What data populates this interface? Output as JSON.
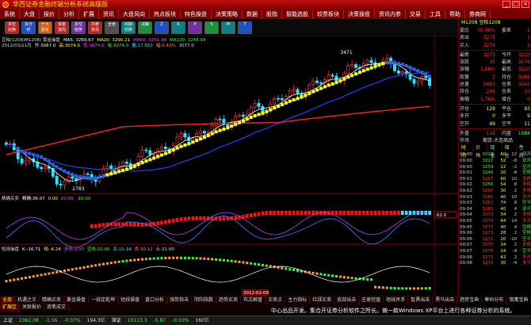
{
  "window": {
    "title": "华西证券金融终端分析系统高级版",
    "buttons": [
      "_",
      "□",
      "×"
    ]
  },
  "menu": [
    "系统",
    "大盘",
    "报价",
    "分析",
    "扩展",
    "资讯",
    "大盘风向",
    "热点板块",
    "特色操盘",
    "决策策略",
    "数据",
    "股指",
    "智能选股",
    "较票板块",
    "决策操盘",
    "资讯内参",
    "交易",
    "工具",
    "帮助",
    "券商网"
  ],
  "toolbar": [
    {
      "label": "多空 切换",
      "color": "red"
    },
    {
      "label": "多分 时",
      "color": "blue"
    },
    {
      "label": "十大 股东",
      "color": "orange"
    },
    {
      "label": "资金 流向",
      "color": "red"
    },
    {
      "label": "多空 趋势",
      "color": "purple"
    },
    {
      "label": "内参 资讯",
      "color": "red"
    },
    {
      "label": "全景",
      "color": "gray"
    },
    {
      "label": "周期 切换",
      "color": "teal"
    },
    {
      "label": "决策",
      "color": "green"
    },
    {
      "label": "Z",
      "color": "blue"
    },
    {
      "label": "K",
      "color": "teal"
    },
    {
      "label": "P",
      "color": "purple"
    },
    {
      "label": "S",
      "color": "green"
    },
    {
      "label": "M",
      "color": "teal"
    },
    {
      "label": "T",
      "color": "blue"
    }
  ],
  "legend1": [
    "豆粕(1208)M1208) 黄金操盘",
    "MA5: 3269.67",
    "MA20: 3290.21",
    "MA60: 3251.48",
    "MA120: 3248.93"
  ],
  "legend2": [
    "2012(03)11月",
    "开:3067.0",
    "高:3074.0",
    "低:3074.0",
    "收:3074.0",
    "量:17.653",
    "幅:0.43%",
    "3077.0"
  ],
  "legend3": [
    "精确买卖",
    "精确:36.07",
    "0.00",
    "20.00",
    "-10.00"
  ],
  "legend4": [
    "短线操盘",
    "K:-16.71",
    "线:-4.24",
    "多线:0.00",
    "空线:20.00",
    "买:10.14",
    "卖:30.12",
    "止:21.00"
  ],
  "annot": {
    "peak": "3471",
    "low": "2783",
    "date": "2012-02-09",
    "right_label": "62.0"
  },
  "chart_data": {
    "type": "candlestick",
    "y_range": [
      2750,
      3500
    ],
    "peak_label": 3471,
    "low_label": 2783
  },
  "right": {
    "header": "M1208 豆粕1208",
    "book": [
      [
        "委比",
        "50.00%",
        "委差",
        "2"
      ],
      [
        "卖出",
        "3275",
        "",
        "1"
      ],
      [
        "买入",
        "3274",
        "",
        "3"
      ]
    ],
    "quote": [
      [
        "最新",
        "3273",
        "今开",
        "3220"
      ],
      [
        "涨跌",
        "35",
        "最高",
        "3276"
      ],
      [
        "涨幅",
        "1.08%",
        "最低",
        "3220"
      ],
      [
        "现量",
        "2",
        "持仓",
        "3386"
      ],
      [
        "总量",
        "2403",
        "仓差",
        "3245"
      ],
      [
        "持仓",
        "206",
        "仓差",
        "10"
      ],
      [
        "振幅",
        "1.76%",
        "增仓",
        "0"
      ]
    ],
    "flow": [
      [
        "开仓",
        "129",
        "平仓",
        "93"
      ],
      [
        "多开",
        "0",
        "多平",
        "9"
      ],
      [
        "空开",
        "49",
        "空平",
        "11"
      ]
    ],
    "outer": [
      "外盘",
      "116",
      "内盘",
      "1084"
    ],
    "market": [
      "市场",
      "期货-大连商品"
    ],
    "tabs": [
      "时间",
      "价格",
      "现量",
      "增仓",
      "性质"
    ],
    "ticks": [
      [
        "09:00",
        "3222",
        "60",
        "12",
        "双开"
      ],
      [
        "09:00",
        "3222",
        "52",
        "-8",
        "双开"
      ],
      [
        "09:00",
        "3254",
        "22",
        "-2",
        "空开"
      ],
      [
        "09:01",
        "3246",
        "20",
        "-8",
        "空换"
      ],
      [
        "09:01",
        "3257",
        "60",
        "10",
        "多换"
      ],
      [
        "09:02",
        "3256",
        "54",
        "8",
        "多换"
      ],
      [
        "09:02",
        "3267",
        "30",
        "2",
        "多换"
      ],
      [
        "09:03",
        "3265",
        "40",
        "10",
        "多开"
      ],
      [
        "09:03",
        "3257",
        "74",
        "8",
        "空平"
      ],
      [
        "09:04",
        "3265",
        "40",
        "4",
        "双平"
      ],
      [
        "09:04",
        "3273",
        "34",
        "2",
        "多换"
      ],
      [
        "09:05",
        "3274",
        "44",
        "14",
        "多开"
      ],
      [
        "09:05",
        "3277",
        "40",
        "4",
        "空换"
      ],
      [
        "09:06",
        "3273",
        "28",
        "2",
        "空换"
      ],
      [
        "09:06",
        "3271",
        "20",
        "-10",
        "空平"
      ],
      [
        "09:07",
        "3270",
        "34",
        "2",
        "多换"
      ],
      [
        "09:07",
        "3275",
        "24",
        "-4",
        "空平"
      ],
      [
        "09:08",
        "3273",
        "42",
        "2",
        "多开"
      ],
      [
        "09:08",
        "3275",
        "30",
        "-4",
        "多平"
      ]
    ]
  },
  "bottom_tabs1": [
    "全部",
    "机遇之王",
    "精确买卖",
    "黄金操盘",
    "一线定乾坤",
    "短线操盘",
    "盘口分析",
    "强势指击",
    "阴阳指数",
    "趋势买卖",
    "布志解盘",
    "买卖点",
    "主力指标",
    "红绿买卖",
    "底部出击",
    "庄家控盘",
    "短线杀手",
    "智勇出击",
    "黑马出击",
    "趋势宝典",
    "筹码分布",
    "猎鹰宝典"
  ],
  "bottom_tabs2": [
    "扩展区",
    "关联报价",
    "逐笔成交"
  ],
  "status": [
    "上证",
    "2362.08",
    "-1.56",
    "-0.07%",
    "194.3亿",
    "深证",
    "10113.3",
    "-5.87",
    "-0.10%",
    "160亿"
  ],
  "marquee": "中心出品开发。集合开证券分析软件之所长。做一款Windows XP平台上进行各种证券分析的系统。"
}
